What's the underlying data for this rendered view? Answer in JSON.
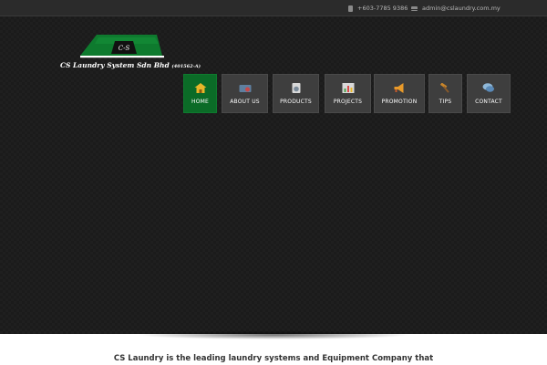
{
  "topbar": {
    "phone": "+603-7785 9386",
    "email": "admin@cslaundry.com.my",
    "phone_icon": "phone-icon",
    "email_icon": "envelope-icon"
  },
  "logo": {
    "emblem_text": "C-S",
    "company": "CS Laundry System Sdn Bhd",
    "reg_no": "(401562-A)"
  },
  "nav": [
    {
      "label": "HOME",
      "icon": "home-icon",
      "active": true
    },
    {
      "label": "ABOUT US",
      "icon": "about-icon",
      "active": false
    },
    {
      "label": "PRODUCTS",
      "icon": "washer-icon",
      "active": false
    },
    {
      "label": "PROJECTS",
      "icon": "chart-icon",
      "active": false
    },
    {
      "label": "PROMOTION",
      "icon": "megaphone-icon",
      "active": false
    },
    {
      "label": "TIPS",
      "icon": "hammer-icon",
      "active": false
    },
    {
      "label": "CONTACT",
      "icon": "chat-icon",
      "active": false
    }
  ],
  "intro": {
    "line1": "CS Laundry is the leading laundry systems and Equipment Company that"
  },
  "colors": {
    "active_nav": "#0b6b27",
    "logo_green": "#0e7a2e",
    "nav_bg": "#3e3e3e"
  }
}
